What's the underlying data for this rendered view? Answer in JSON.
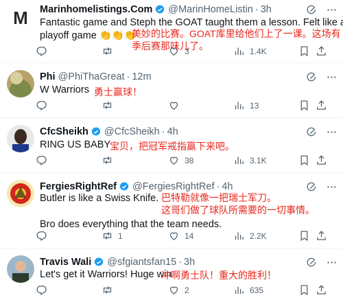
{
  "tweets": [
    {
      "name": "Marinhomelistings.Com",
      "handle": "@MarinHomeListin",
      "time": "3h",
      "text": [
        "Fantastic game and Steph the GOAT taught them a lesson. Felt like a",
        "playoff game 👏👏👏"
      ],
      "translation": [
        "美妙的比赛。GOAT库里给他们上了一课。这场有",
        "季后赛那味儿了。"
      ],
      "replies": "",
      "retweets": "",
      "likes": "3",
      "views": "1.4K",
      "avatar": "M"
    },
    {
      "name": "Phi",
      "handle": "@PhiThaGreat",
      "time": "12m",
      "text": [
        "W Warriors"
      ],
      "translation": [
        "勇士赢球！"
      ],
      "replies": "",
      "retweets": "",
      "likes": "",
      "views": "13"
    },
    {
      "name": "CfcSheikh",
      "handle": "@CfcSheikh",
      "time": "4h",
      "text": [
        "RING US BABY"
      ],
      "translation": [
        "宝贝，把冠军戒指赢下来吧。"
      ],
      "replies": "",
      "retweets": "",
      "likes": "38",
      "views": "3.1K"
    },
    {
      "name": "FergiesRightRef",
      "handle": "@FergiesRightRef",
      "time": "4h",
      "text": [
        "Butler is like a Swiss Knife.",
        "Bro does everything that the team needs."
      ],
      "translation": [
        "巴特勒就像一把瑞士军刀。",
        "这哥们做了球队所需要的一切事情。"
      ],
      "replies": "",
      "retweets": "1",
      "likes": "14",
      "views": "2.2K"
    },
    {
      "name": "Travis Wali",
      "handle": "@sfgiantsfan15",
      "time": "3h",
      "text": [
        "Let's get it Warriors! Huge win"
      ],
      "translation": [
        "冲啊勇士队！重大的胜利！"
      ],
      "replies": "",
      "retweets": "",
      "likes": "2",
      "views": "635"
    }
  ],
  "colors": {
    "verified": "#1d9bf0",
    "translation": "#e8281e",
    "muted": "#536471"
  }
}
